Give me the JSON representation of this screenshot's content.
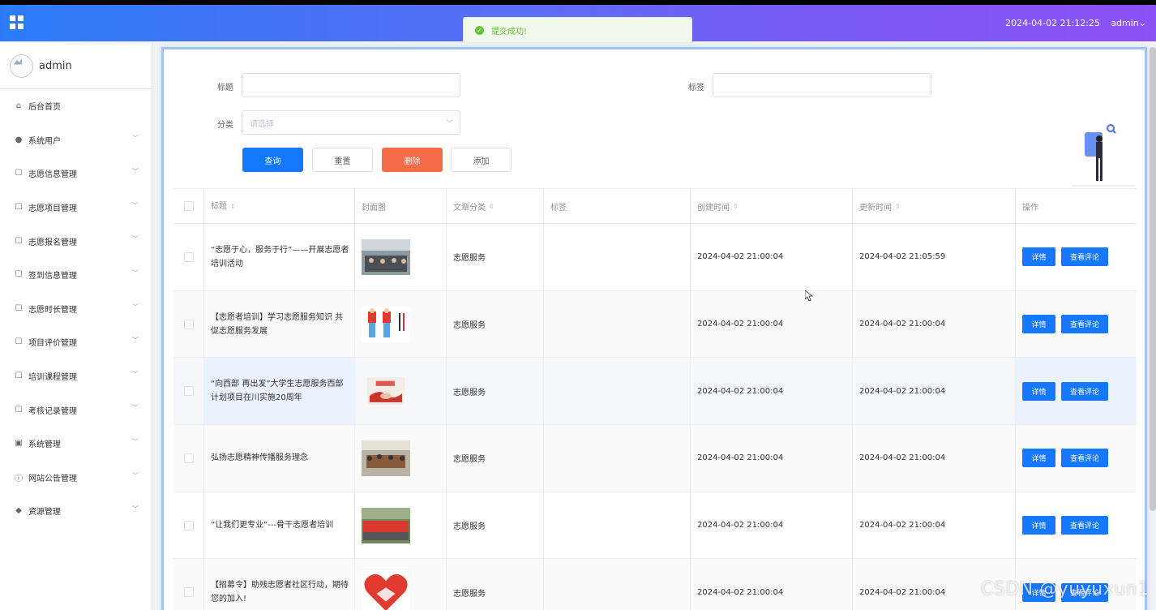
{
  "header": {
    "datetime": "2024-04-02 21:12:25",
    "user_menu": "admin",
    "gradient": [
      "#2b7bf8",
      "#8c52f3"
    ]
  },
  "toast": {
    "message": "提交成功!",
    "icon": "check-circle-icon",
    "color": "#67c23a"
  },
  "sidebar": {
    "username": "admin",
    "items": [
      {
        "label": "后台首页",
        "icon": "home-icon",
        "has_children": false
      },
      {
        "label": "系统用户",
        "icon": "user-icon",
        "has_children": true
      },
      {
        "label": "志愿信息管理",
        "icon": "document-icon",
        "has_children": true
      },
      {
        "label": "志愿项目管理",
        "icon": "document-icon",
        "has_children": true
      },
      {
        "label": "志愿报名管理",
        "icon": "document-icon",
        "has_children": true
      },
      {
        "label": "签到信息管理",
        "icon": "document-icon",
        "has_children": true
      },
      {
        "label": "志愿时长管理",
        "icon": "document-icon",
        "has_children": true
      },
      {
        "label": "项目评价管理",
        "icon": "document-icon",
        "has_children": true
      },
      {
        "label": "培训课程管理",
        "icon": "document-icon",
        "has_children": true
      },
      {
        "label": "考核记录管理",
        "icon": "document-icon",
        "has_children": true
      },
      {
        "label": "系统管理",
        "icon": "picture-icon",
        "has_children": true
      },
      {
        "label": "网站公告管理",
        "icon": "info-icon",
        "has_children": true
      },
      {
        "label": "资源管理",
        "icon": "location-icon",
        "has_children": true
      }
    ]
  },
  "search": {
    "title_label": "标题",
    "title_value": "",
    "tag_label": "标签",
    "tag_value": "",
    "category_label": "分类",
    "category_placeholder": "请选择",
    "buttons": {
      "query": "查询",
      "reset": "重置",
      "delete": "删除",
      "add": "添加"
    },
    "accent": "#1677ff",
    "danger": "#f56c4a"
  },
  "table": {
    "headers": {
      "title": "标题",
      "cover": "封面图",
      "category": "文章分类",
      "tag": "标签",
      "created": "创建时间",
      "updated": "更新时间",
      "ops": "操作"
    },
    "rows": [
      {
        "title": "“志愿于心，服务于行”——开展志愿者培训活动",
        "cover": "training-photo",
        "category": "志愿服务",
        "tag": "",
        "created": "2024-04-02 21:00:04",
        "updated": "2024-04-02 21:05:59"
      },
      {
        "title": "【志愿者培训】学习志愿服务知识 共促志愿服务发展",
        "cover": "volunteer-cartoon",
        "category": "志愿服务",
        "tag": "",
        "created": "2024-04-02 21:00:04",
        "updated": "2024-04-02 21:00:04"
      },
      {
        "title": "“向西部 再出发”大学生志愿服务西部计划项目在川实施20周年",
        "cover": "handshake-banner",
        "category": "志愿服务",
        "tag": "",
        "created": "2024-04-02 21:00:04",
        "updated": "2024-04-02 21:00:04"
      },
      {
        "title": "弘扬志愿精神传播服务理念",
        "cover": "meeting-photo",
        "category": "志愿服务",
        "tag": "",
        "created": "2024-04-02 21:00:04",
        "updated": "2024-04-02 21:00:04"
      },
      {
        "title": "“让我们更专业”---骨干志愿者培训",
        "cover": "group-photo",
        "category": "志愿服务",
        "tag": "",
        "created": "2024-04-02 21:00:04",
        "updated": "2024-04-02 21:00:04"
      },
      {
        "title": "【招募令】助残志愿者社区行动，期待您的加入!",
        "cover": "heart-hands",
        "category": "志愿服务",
        "tag": "",
        "created": "2024-04-02 21:00:04",
        "updated": "2024-04-02 21:00:04"
      }
    ],
    "op_detail": "详情",
    "op_comment": "查看评论"
  },
  "watermark": "CSDN @yuyuxun1"
}
